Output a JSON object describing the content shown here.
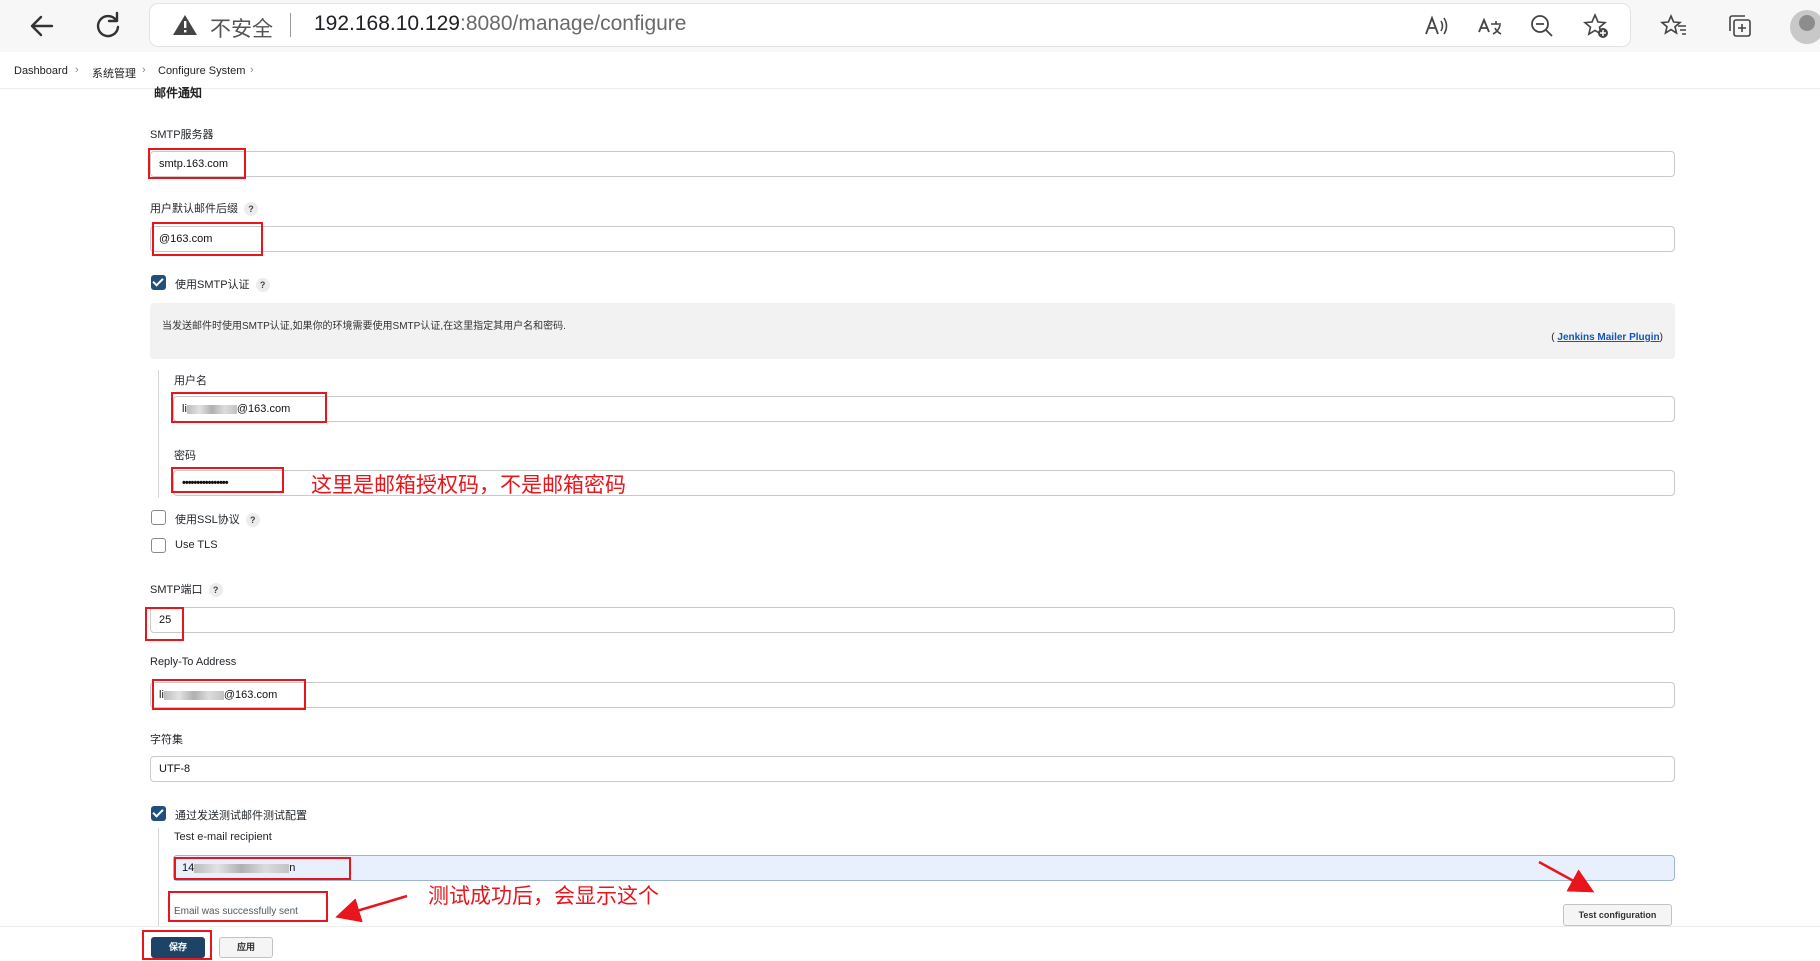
{
  "browser": {
    "security_label": "不安全",
    "url_host": "192.168.10.129",
    "url_rest": ":8080/manage/configure"
  },
  "breadcrumb": {
    "items": [
      "Dashboard",
      "系统管理",
      "Configure System"
    ]
  },
  "form": {
    "section_title": "邮件通知",
    "smtp_server_label": "SMTP服务器",
    "smtp_server_value": "smtp.163.com",
    "default_suffix_label": "用户默认邮件后缀",
    "default_suffix_value": "@163.com",
    "use_smtp_auth_label": "使用SMTP认证",
    "use_smtp_auth_checked": true,
    "auth_description": "当发送邮件时使用SMTP认证,如果你的环境需要使用SMTP认证,在这里指定其用户名和密码.",
    "plugin_link": "Jenkins Mailer Plugin",
    "plugin_paren_open": "(",
    "plugin_paren_close": ")",
    "username_label": "用户名",
    "username_prefix": "li",
    "username_suffix": "@163.com",
    "password_label": "密码",
    "password_value": "••••••••••••••••",
    "use_ssl_label": "使用SSL协议",
    "use_ssl_checked": false,
    "use_tls_label": "Use TLS",
    "use_tls_checked": false,
    "smtp_port_label": "SMTP端口",
    "smtp_port_value": "25",
    "reply_to_label": "Reply-To Address",
    "reply_to_prefix": "li",
    "reply_to_suffix": "@163.com",
    "charset_label": "字符集",
    "charset_value": "UTF-8",
    "test_send_label": "通过发送测试邮件测试配置",
    "test_send_checked": true,
    "test_recipient_label": "Test e-mail recipient",
    "test_recipient_prefix": "14",
    "test_recipient_suffix": "n",
    "success_message": "Email was successfully sent",
    "test_button": "Test configuration",
    "help_glyph": "?"
  },
  "footer": {
    "save_button": "保存",
    "apply_button": "应用"
  },
  "annotations": {
    "password_note": "这里是邮箱授权码，不是邮箱密码",
    "success_note": "测试成功后，会显示这个"
  },
  "colors": {
    "annotation_red": "#e8161c",
    "checkbox_blue": "#1f4f7a",
    "primary_button": "#1d4466",
    "link_blue": "#1456b8"
  },
  "icons": [
    "back-arrow-icon",
    "refresh-icon",
    "warning-icon",
    "read-aloud-icon",
    "translate-icon",
    "zoom-out-icon",
    "add-favorite-icon",
    "favorites-icon",
    "collections-icon",
    "profile-avatar",
    "chevron-right-icon",
    "help-icon"
  ]
}
